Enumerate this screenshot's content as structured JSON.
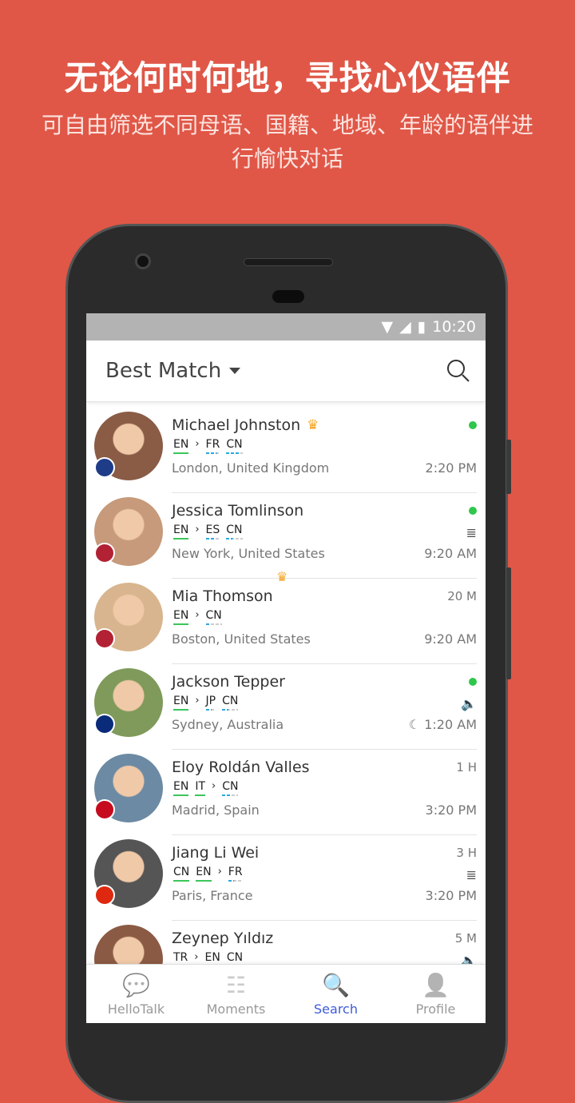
{
  "promo": {
    "headline": "无论何时何地，寻找心仪语伴",
    "subtitle": "可自由筛选不同母语、国籍、地域、年龄的语伴进行愉快对话"
  },
  "status_bar": {
    "time": "10:20"
  },
  "header": {
    "title": "Best Match",
    "icon": "search-icon"
  },
  "colors": {
    "background": "#e05747",
    "native": "#3cc55a",
    "learning": "#2aa7e0",
    "online": "#2fc64c",
    "accent": "#3d5bd9",
    "crown": "#f5a623"
  },
  "users": [
    {
      "name": "Michael Johnston",
      "vip": true,
      "flag": "UK",
      "langs": [
        {
          "code": "EN",
          "type": "native"
        },
        {
          "code": "FR",
          "type": "learning",
          "level": 0.8
        },
        {
          "code": "CN",
          "type": "learning",
          "level": 0.8
        }
      ],
      "location": "London, United Kingdom",
      "top_right": "",
      "online": true,
      "mid_icon": "",
      "time": "2:20 PM",
      "avatar": "#8a5b45"
    },
    {
      "name": "Jessica Tomlinson",
      "vip": false,
      "flag": "US",
      "langs": [
        {
          "code": "EN",
          "type": "native"
        },
        {
          "code": "ES",
          "type": "learning",
          "level": 0.6
        },
        {
          "code": "CN",
          "type": "learning",
          "level": 0.4
        }
      ],
      "location": "New York, United States",
      "top_right": "",
      "online": true,
      "mid_icon": "≣",
      "time": "9:20 AM",
      "avatar": "#c69a7a"
    },
    {
      "name": "Mia Thomson",
      "vip": false,
      "flag": "US",
      "langs": [
        {
          "code": "EN",
          "type": "native"
        },
        {
          "code": "CN",
          "type": "learning",
          "level": 0.2
        }
      ],
      "location": "Boston, United States",
      "top_right": "20 M",
      "online": false,
      "mid_icon": "",
      "time": "9:20 AM",
      "avatar": "#d8b58e"
    },
    {
      "name": "Jackson Tepper",
      "vip": false,
      "flag": "AU",
      "langs": [
        {
          "code": "EN",
          "type": "native"
        },
        {
          "code": "JP",
          "type": "learning",
          "level": 0.6
        },
        {
          "code": "CN",
          "type": "learning",
          "level": 0.4
        }
      ],
      "location": "Sydney, Australia",
      "top_right": "",
      "online": true,
      "mid_icon": "🔈",
      "time": "☾ 1:20 AM",
      "avatar": "#7f9a5a"
    },
    {
      "name": "Eloy Roldán Valles",
      "vip": false,
      "flag": "ES",
      "langs": [
        {
          "code": "EN",
          "type": "native"
        },
        {
          "code": "IT",
          "type": "native"
        },
        {
          "code": "CN",
          "type": "learning",
          "level": 0.6
        }
      ],
      "location": "Madrid, Spain",
      "top_right": "1 H",
      "online": false,
      "mid_icon": "",
      "time": "3:20 PM",
      "avatar": "#6c8aa3"
    },
    {
      "name": "Jiang Li Wei",
      "vip": false,
      "flag": "CN",
      "langs": [
        {
          "code": "CN",
          "type": "native"
        },
        {
          "code": "EN",
          "type": "native"
        },
        {
          "code": "FR",
          "type": "learning",
          "level": 0.4
        }
      ],
      "location": "Paris, France",
      "top_right": "3 H",
      "online": false,
      "mid_icon": "≣",
      "time": "3:20 PM",
      "avatar": "#555"
    },
    {
      "name": "Zeynep Yıldız",
      "vip": false,
      "flag": "TR",
      "langs": [
        {
          "code": "TR",
          "type": "native"
        },
        {
          "code": "EN",
          "type": "learning",
          "level": 0.6
        },
        {
          "code": "CN",
          "type": "learning",
          "level": 0.4
        }
      ],
      "location": "",
      "top_right": "5 M",
      "online": false,
      "mid_icon": "🔈",
      "time": "",
      "avatar": "#8b5a44"
    }
  ],
  "tabs": [
    {
      "label": "HelloTalk",
      "icon": "chat-bubbles-icon",
      "glyph": "💬"
    },
    {
      "label": "Moments",
      "icon": "moments-icon",
      "glyph": "☷"
    },
    {
      "label": "Search",
      "icon": "search-icon",
      "glyph": "🔍",
      "active": true
    },
    {
      "label": "Profile",
      "icon": "profile-icon",
      "glyph": "👤"
    }
  ]
}
